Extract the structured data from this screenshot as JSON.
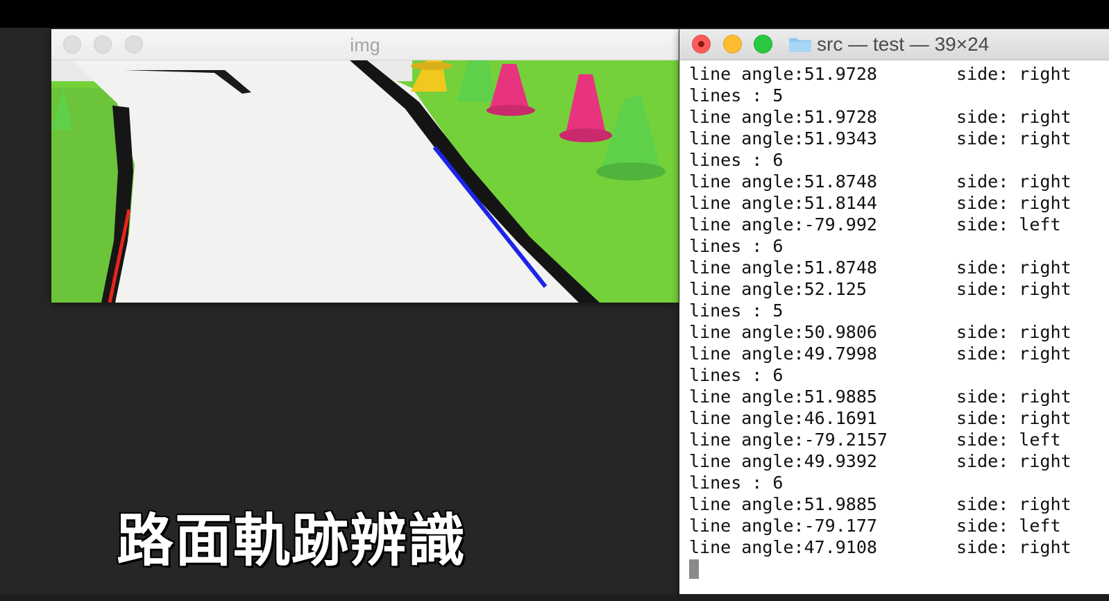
{
  "img_window": {
    "title": "img",
    "detected_lines": [
      {
        "side": "left",
        "color": "#e8231c"
      },
      {
        "side": "right",
        "color": "#1c24e8"
      }
    ]
  },
  "terminal": {
    "title": "src — test — 39×24",
    "lines": [
      {
        "a": "line angle:51.9728",
        "b": "side: right"
      },
      {
        "a": "lines : 5",
        "b": ""
      },
      {
        "a": "line angle:51.9728",
        "b": "side: right"
      },
      {
        "a": "line angle:51.9343",
        "b": "side: right"
      },
      {
        "a": "lines : 6",
        "b": ""
      },
      {
        "a": "line angle:51.8748",
        "b": "side: right"
      },
      {
        "a": "line angle:51.8144",
        "b": "side: right"
      },
      {
        "a": "line angle:-79.992",
        "b": "side: left"
      },
      {
        "a": "lines : 6",
        "b": ""
      },
      {
        "a": "line angle:51.8748",
        "b": "side: right"
      },
      {
        "a": "line angle:52.125",
        "b": "side: right"
      },
      {
        "a": "lines : 5",
        "b": ""
      },
      {
        "a": "line angle:50.9806",
        "b": "side: right"
      },
      {
        "a": "line angle:49.7998",
        "b": "side: right"
      },
      {
        "a": "lines : 6",
        "b": ""
      },
      {
        "a": "line angle:51.9885",
        "b": "side: right"
      },
      {
        "a": "line angle:46.1691",
        "b": "side: right"
      },
      {
        "a": "line angle:-79.2157",
        "b": "side: left"
      },
      {
        "a": "line angle:49.9392",
        "b": "side: right"
      },
      {
        "a": "lines : 6",
        "b": ""
      },
      {
        "a": "line angle:51.9885",
        "b": "side: right"
      },
      {
        "a": "line angle:-79.177",
        "b": "side: left"
      },
      {
        "a": "line angle:47.9108",
        "b": "side: right"
      }
    ]
  },
  "caption": "路面軌跡辨識",
  "colors": {
    "background": "#262624",
    "grass": "#74d13a",
    "cone_pink": "#e8347f",
    "cone_yellow": "#f0c81e",
    "cone_green": "#5fd04a"
  }
}
